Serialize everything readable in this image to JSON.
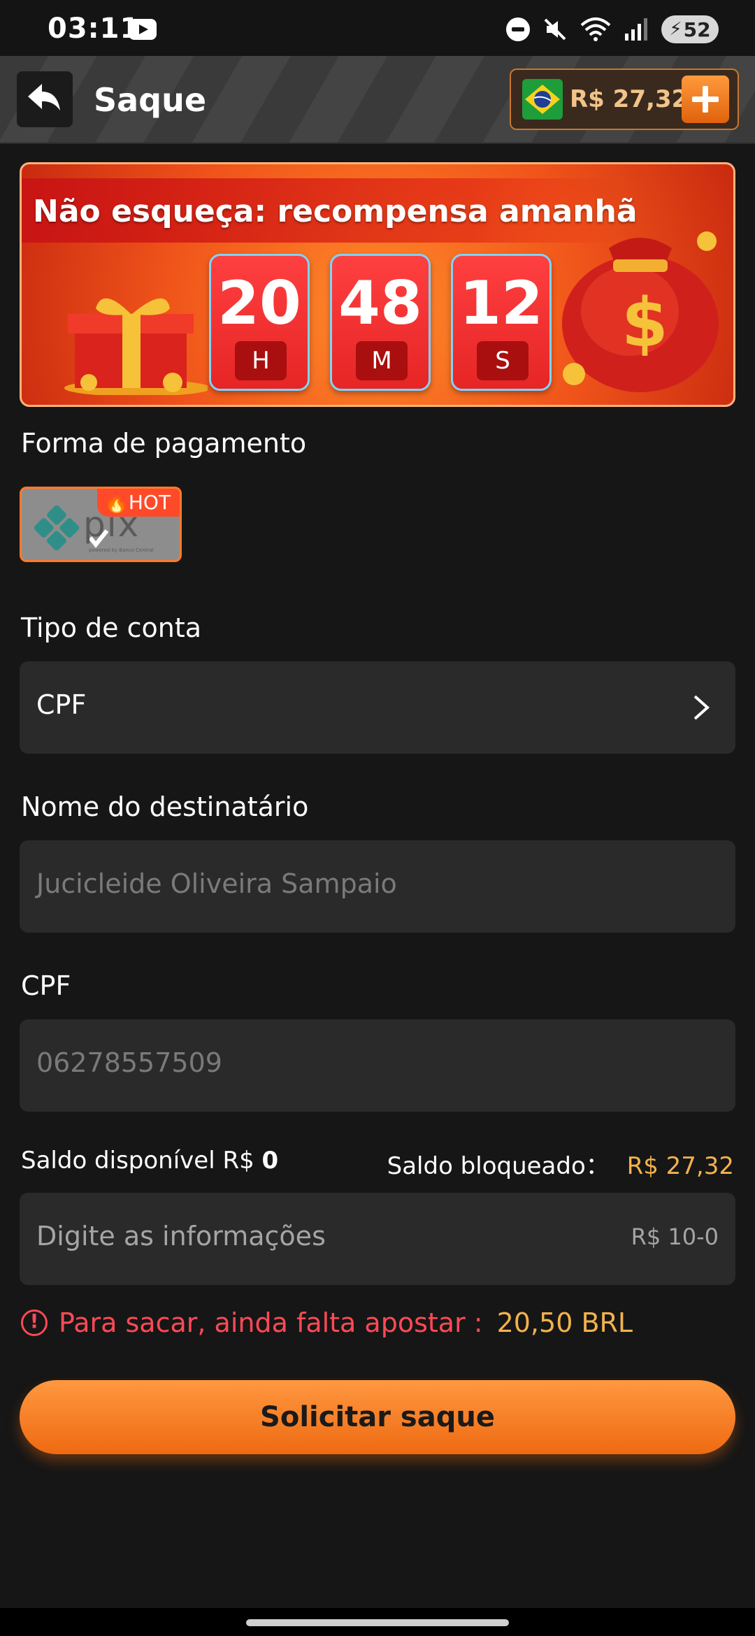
{
  "status_bar": {
    "time": "03:11",
    "battery": "52",
    "icons": [
      "youtube-icon",
      "dnd-icon",
      "mute-icon",
      "wifi-icon",
      "signal-icon",
      "battery-icon"
    ]
  },
  "header": {
    "title": "Saque",
    "balance": "R$ 27,32",
    "country_flag": "brazil-flag-icon"
  },
  "banner": {
    "title": "Não esqueça: recompensa amanhã",
    "countdown": [
      {
        "value": "20",
        "unit": "H"
      },
      {
        "value": "48",
        "unit": "M"
      },
      {
        "value": "12",
        "unit": "S"
      }
    ]
  },
  "payment": {
    "label": "Forma de pagamento",
    "method_name": "pix",
    "method_sub": "powered by Banco Central",
    "badge": "HOT"
  },
  "account_type": {
    "label": "Tipo de conta",
    "value": "CPF"
  },
  "recipient": {
    "label": "Nome do destinatário",
    "value": "Jucicleide Oliveira Sampaio"
  },
  "cpf": {
    "label": "CPF",
    "value": "06278557509"
  },
  "balances": {
    "available_label": "Saldo disponível R$",
    "available_value": "0",
    "blocked_label": "Saldo bloqueado：",
    "blocked_value": "R$ 27,32"
  },
  "amount": {
    "placeholder": "Digite as informações",
    "range": "R$ 10-0"
  },
  "warning": {
    "text": "Para sacar, ainda falta apostar :",
    "amount": "20,50 BRL"
  },
  "submit": {
    "label": "Solicitar saque"
  },
  "colors": {
    "accent": "#ff7a2a",
    "gold": "#f3b24d",
    "warning": "#ff4a55",
    "background": "#161616",
    "field": "#2a2a2a"
  }
}
